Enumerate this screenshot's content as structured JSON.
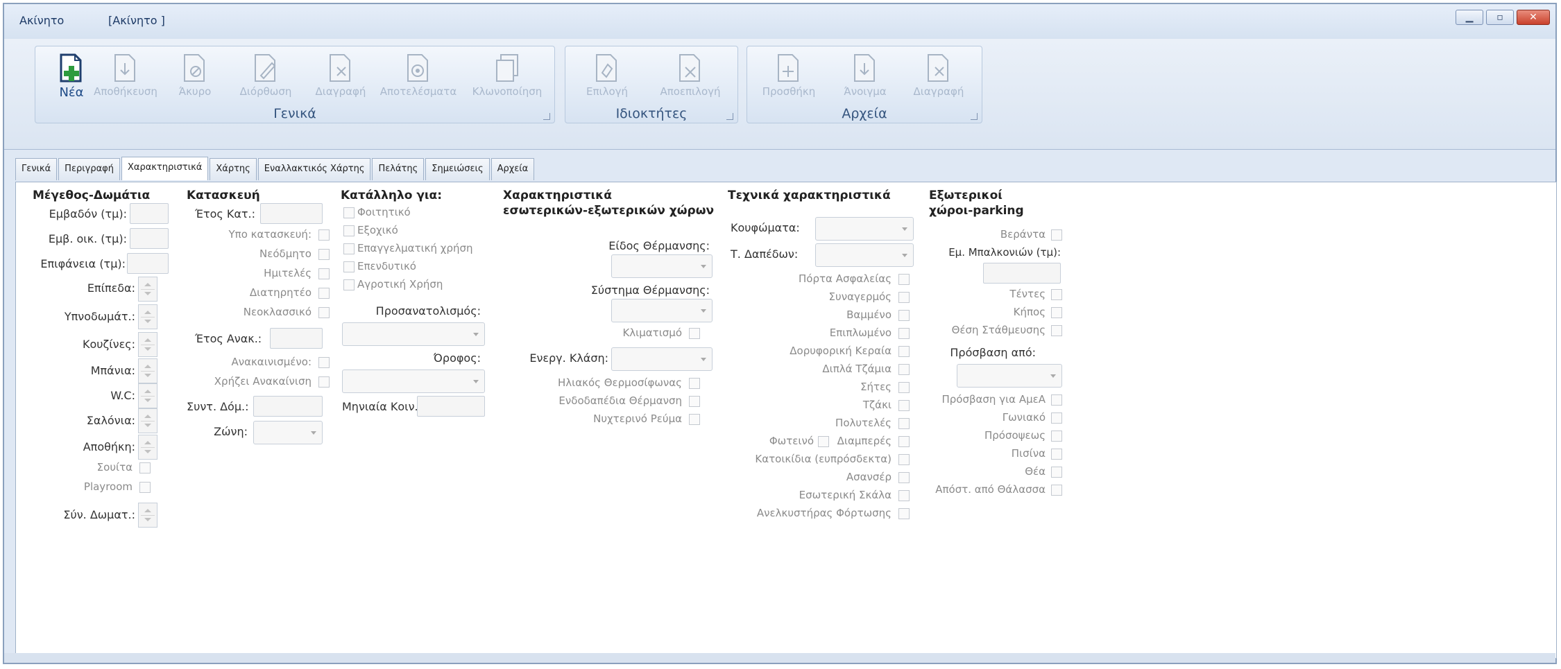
{
  "window": {
    "title_app": "Ακίνητο",
    "title_doc": "[Ακίνητο ]",
    "buttons": {
      "minimize_icon": "minimize-icon",
      "maximize_icon": "maximize-icon",
      "close_icon": "close-icon"
    }
  },
  "ribbon": {
    "general": {
      "label": "Γενικά",
      "buttons": [
        {
          "label": "Νέα",
          "icon": "new-document-icon",
          "enabled": true
        },
        {
          "label": "Αποθήκευση",
          "icon": "save-icon",
          "enabled": false
        },
        {
          "label": "Άκυρο",
          "icon": "cancel-icon",
          "enabled": false
        },
        {
          "label": "Διόρθωση",
          "icon": "edit-icon",
          "enabled": false
        },
        {
          "label": "Διαγραφή",
          "icon": "delete-icon",
          "enabled": false
        },
        {
          "label": "Αποτελέσματα",
          "icon": "results-icon",
          "enabled": false
        },
        {
          "label": "Κλωνοποίηση",
          "icon": "clone-icon",
          "enabled": false
        }
      ]
    },
    "owners": {
      "label": "Ιδιοκτήτες",
      "buttons": [
        {
          "label": "Επιλογή",
          "icon": "select-owner-icon",
          "enabled": false
        },
        {
          "label": "Αποεπιλογή",
          "icon": "deselect-owner-icon",
          "enabled": false
        }
      ]
    },
    "files": {
      "label": "Αρχεία",
      "buttons": [
        {
          "label": "Προσθήκη",
          "icon": "add-file-icon",
          "enabled": false
        },
        {
          "label": "Άνοιγμα",
          "icon": "open-file-icon",
          "enabled": false
        },
        {
          "label": "Διαγραφή",
          "icon": "delete-file-icon",
          "enabled": false
        }
      ]
    }
  },
  "tabs": [
    "Γενικά",
    "Περιγραφή",
    "Χαρακτηριστικά",
    "Χάρτης",
    "Εναλλακτικός Χάρτης",
    "Πελάτης",
    "Σημειώσεις",
    "Αρχεία"
  ],
  "active_tab": "Χαρακτηριστικά",
  "size_rooms": {
    "title": "Μέγεθος-Δωμάτια",
    "area": "Εμβαδόν (τμ):",
    "living_area": "Εμβ. οικ. (τμ):",
    "surface": "Επιφάνεια (τμ):",
    "levels": "Επίπεδα:",
    "bedrooms": "Υπνοδωμάτ.:",
    "kitchens": "Κουζίνες:",
    "bathrooms": "Μπάνια:",
    "wc": "W.C:",
    "living_rooms": "Σαλόνια:",
    "storage": "Αποθήκη:",
    "suite": "Σουίτα",
    "playroom": "Playroom",
    "total_rooms": "Σύν. Δωματ.:"
  },
  "construction": {
    "title": "Κατασκευή",
    "year_built": "Έτος Κατ.:",
    "under_construction": "Υπο κατασκευή:",
    "new_build": "Νεόδμητο",
    "unfinished": "Ημιτελές",
    "listed": "Διατηρητέο",
    "neoclassical": "Νεοκλασσικό",
    "year_renovated": "Έτος Ανακ.:",
    "renovated": "Ανακαινισμένο:",
    "needs_renovation": "Χρήζει Ανακαίνιση",
    "coefficient": "Συντ. Δόμ.:",
    "zone": "Ζώνη:"
  },
  "suitable_for": {
    "title": "Κατάλληλο για:",
    "student": "Φοιτητικό",
    "vacation": "Εξοχικό",
    "professional": "Επαγγελματική χρήση",
    "investment": "Επενδυτικό",
    "agricultural": "Αγροτική Χρήση",
    "orientation": "Προσανατολισμός:",
    "floor": "Όροφος:",
    "monthly_fees": "Μηνιαία Κοιν.:"
  },
  "interior_exterior": {
    "title_line1": "Χαρακτηριστικά",
    "title_line2": "εσωτερικών-εξωτερικών χώρων",
    "heating_type": "Είδος Θέρμανσης:",
    "heating_system": "Σύστημα Θέρμανσης:",
    "air_conditioning": "Κλιματισμό",
    "energy_class": "Ενεργ. Κλάση:",
    "solar_heater": "Ηλιακός Θερμοσίφωνας",
    "underfloor_heating": "Ενδοδαπέδια Θέρμανση",
    "night_power": "Νυχτερινό Ρεύμα"
  },
  "technical": {
    "title": "Τεχνικά χαρακτηριστικά",
    "frames": "Κουφώματα:",
    "floors": "Τ. Δαπέδων:",
    "security_door": "Πόρτα Ασφαλείας",
    "alarm": "Συναγερμός",
    "painted": "Βαμμένο",
    "furnished": "Επιπλωμένο",
    "satellite_dish": "Δορυφορική Κεραία",
    "double_glazing": "Διπλά Τζάμια",
    "attic": "Σήτες",
    "fireplace": "Τζάκι",
    "luxury": "Πολυτελές",
    "bright": "Φωτεινό",
    "through": "Διαμπερές",
    "pets": "Κατοικίδια (ευπρόσδεκτα)",
    "elevator": "Ασανσέρ",
    "internal_stairs": "Εσωτερική Σκάλα",
    "freight_elevator": "Ανελκυστήρας Φόρτωσης"
  },
  "exterior": {
    "title_line1": "Εξωτερικοί",
    "title_line2": "χώροι-parking",
    "veranda": "Βεράντα",
    "balcony_area": "Εμ. Μπαλκονιών (τμ):",
    "awnings": "Τέντες",
    "garden": "Κήπος",
    "parking": "Θέση Στάθμευσης",
    "access_from": "Πρόσβαση από:",
    "disabled_access": "Πρόσβαση για ΑμεΑ",
    "corner": "Γωνιακό",
    "facade": "Πρόσοψεως",
    "pool": "Πισίνα",
    "view": "Θέα",
    "sea_distance": "Απόστ. από Θάλασσα"
  },
  "colors": {
    "accent": "#1d4a86",
    "disabled_text": "#a9b8cc",
    "green_icon": "#2e9b3e"
  }
}
